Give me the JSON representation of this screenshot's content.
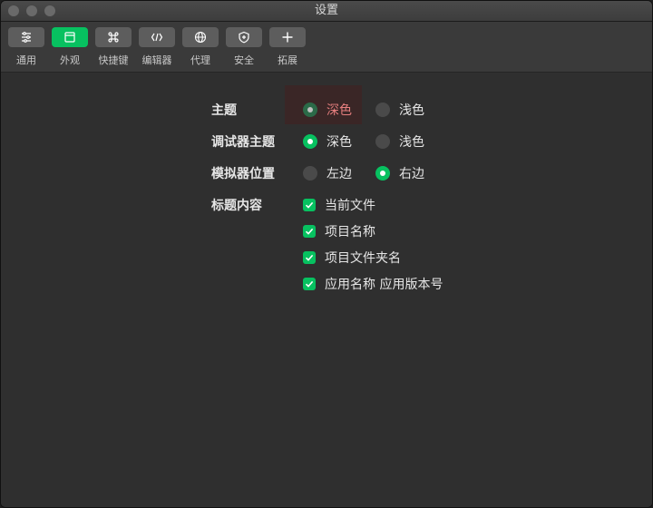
{
  "window": {
    "title": "设置"
  },
  "toolbar": {
    "items": [
      {
        "label": "通用",
        "icon": "sliders-icon",
        "active": false
      },
      {
        "label": "外观",
        "icon": "window-icon",
        "active": true
      },
      {
        "label": "快捷键",
        "icon": "command-icon",
        "active": false
      },
      {
        "label": "编辑器",
        "icon": "code-icon",
        "active": false
      },
      {
        "label": "代理",
        "icon": "globe-icon",
        "active": false
      },
      {
        "label": "安全",
        "icon": "shield-icon",
        "active": false
      },
      {
        "label": "拓展",
        "icon": "plus-icon",
        "active": false
      }
    ]
  },
  "settings": {
    "theme": {
      "label": "主题",
      "options": [
        "深色",
        "浅色"
      ],
      "selected": "深色"
    },
    "debugger_theme": {
      "label": "调试器主题",
      "options": [
        "深色",
        "浅色"
      ],
      "selected": "深色"
    },
    "simulator_position": {
      "label": "模拟器位置",
      "options": [
        "左边",
        "右边"
      ],
      "selected": "右边"
    },
    "title_content": {
      "label": "标题内容",
      "options": [
        "当前文件",
        "项目名称",
        "项目文件夹名",
        "应用名称 应用版本号"
      ],
      "checked": [
        true,
        true,
        true,
        true
      ]
    }
  },
  "colors": {
    "accent": "#07c160",
    "hover_text": "#e77f7f"
  }
}
